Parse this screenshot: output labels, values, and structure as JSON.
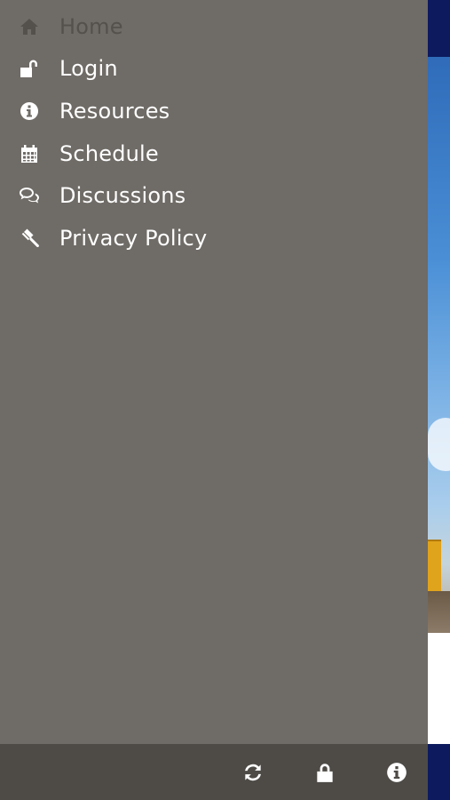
{
  "menu": {
    "items": [
      {
        "label": "Home",
        "icon": "home-icon",
        "active": true
      },
      {
        "label": "Login",
        "icon": "unlock-icon",
        "active": false
      },
      {
        "label": "Resources",
        "icon": "info-circle-icon",
        "active": false
      },
      {
        "label": "Schedule",
        "icon": "calendar-icon",
        "active": false
      },
      {
        "label": "Discussions",
        "icon": "chat-bubbles-icon",
        "active": false
      },
      {
        "label": "Privacy Policy",
        "icon": "gavel-icon",
        "active": false
      }
    ]
  },
  "toolbar": {
    "buttons": [
      {
        "icon": "refresh-icon"
      },
      {
        "icon": "lock-icon"
      },
      {
        "icon": "info-circle-icon"
      }
    ]
  },
  "colors": {
    "drawer_bg": "#6f6b66",
    "toolbar_bg": "#4e4b47",
    "active_text": "#54514d",
    "text": "#ffffff",
    "app_navy": "#0d1a5e"
  }
}
